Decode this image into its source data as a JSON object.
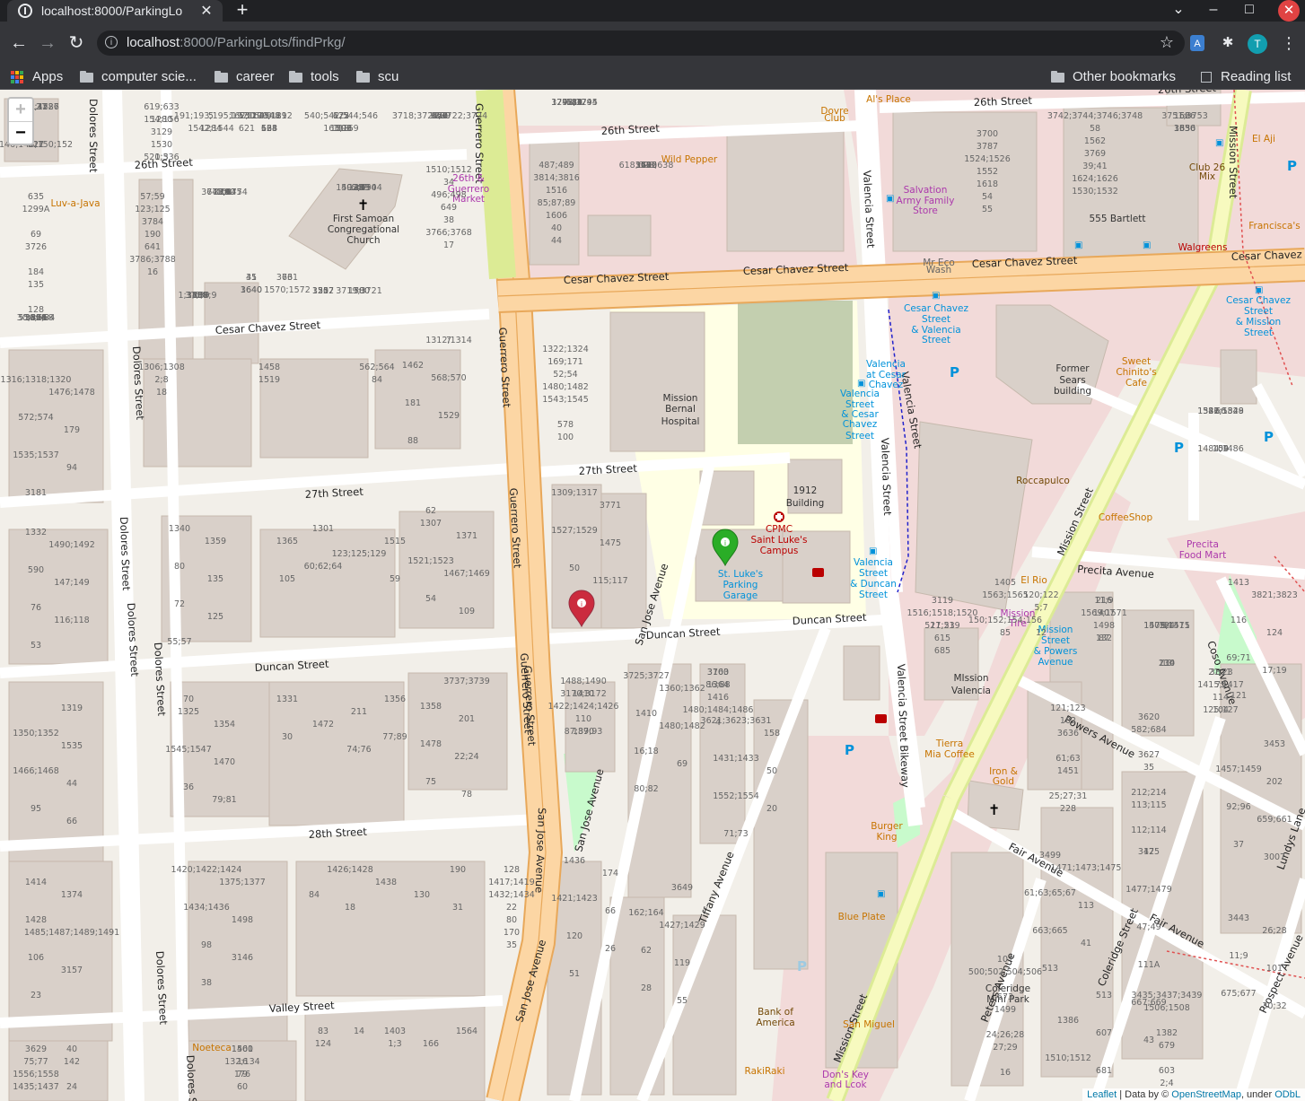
{
  "browser": {
    "tab_title": "localhost:8000/ParkingLo",
    "tab_close": "✕",
    "new_tab": "+",
    "url_host": "localhost",
    "url_rest": ":8000/ParkingLots/findPrkg/",
    "avatar_letter": "T",
    "bookmarks": [
      {
        "label": "Apps",
        "kind": "apps"
      },
      {
        "label": "computer scie...",
        "kind": "folder"
      },
      {
        "label": "career",
        "kind": "folder"
      },
      {
        "label": "tools",
        "kind": "folder"
      },
      {
        "label": "scu",
        "kind": "folder"
      }
    ],
    "other_bookmarks": "Other bookmarks",
    "reading_list": "Reading list"
  },
  "map": {
    "zoom_in": "+",
    "zoom_out": "−",
    "attribution": {
      "leaflet": "Leaflet",
      "sep1": " | Data by © ",
      "osm": "OpenStreetMap",
      "sep2": ", under ",
      "odbl": "ODbL"
    },
    "colors": {
      "background": "#f2efe9",
      "building": "#d9d0c9",
      "primary_road": "#fcd6a4",
      "secondary_road": "#f7fabf",
      "residential_road": "#ffffff",
      "commercial": "#f2dad9",
      "hospital": "#ffffe5",
      "park": "#c8facc",
      "marker_green": "#2aad27",
      "marker_red": "#cb2b3e"
    },
    "street_labels": [
      "26th Street",
      "26th Street",
      "26th Street",
      "26th Street",
      "Cesar Chavez Street",
      "Cesar Chavez Street",
      "Cesar Chavez Street",
      "Cesar Chavez Street",
      "Cesar Chavez Street",
      "27th Street",
      "27th Street",
      "Duncan Street",
      "Duncan Street",
      "Duncan Street",
      "28th Street",
      "Valley Street",
      "Dolores Street",
      "Dolores Street",
      "Dolores Street",
      "Dolores Street",
      "Dolores Street",
      "Dolores Street",
      "Dolores Street",
      "Guerrero Street",
      "Guerrero Street",
      "Guerrero Street",
      "Guerrero Street",
      "Guerrero Street",
      "San Jose Avenue",
      "San Jose Avenue",
      "San Jose Avenue",
      "San Jose Avenue",
      "Valencia Street",
      "Valencia Street",
      "Valencia Street",
      "Valencia Street Bikeway",
      "Mission Street",
      "Mission Street",
      "Mission Street",
      "Tiffany Avenue",
      "Precita Avenue",
      "Powers Avenue",
      "Fair Avenue",
      "Fair Avenue",
      "Coso Avenue",
      "Coleridge Street",
      "Peters Avenue",
      "Prospect Avenue",
      "Lundys Lane"
    ],
    "poi_labels": [
      {
        "text": "First Samoan",
        "color": "#333333"
      },
      {
        "text": "Congregational",
        "color": "#333333"
      },
      {
        "text": "Church",
        "color": "#333333"
      },
      {
        "text": "26th &",
        "color": "#ac39ac"
      },
      {
        "text": "Guerrero",
        "color": "#ac39ac"
      },
      {
        "text": "Market",
        "color": "#ac39ac"
      },
      {
        "text": "Wild Pepper",
        "color": "#c77400"
      },
      {
        "text": "Luv-a-Java",
        "color": "#c77400"
      },
      {
        "text": "Dovre",
        "color": "#c77400"
      },
      {
        "text": "Club",
        "color": "#c77400"
      },
      {
        "text": "Al's Place",
        "color": "#c77400"
      },
      {
        "text": "Salvation",
        "color": "#ac39ac"
      },
      {
        "text": "Army Family",
        "color": "#ac39ac"
      },
      {
        "text": "Store",
        "color": "#ac39ac"
      },
      {
        "text": "Mr Eco",
        "color": "#666666"
      },
      {
        "text": "Wash",
        "color": "#666666"
      },
      {
        "text": "555 Bartlett",
        "color": "#333333"
      },
      {
        "text": "Walgreens",
        "color": "#ba0000"
      },
      {
        "text": "Club 26",
        "color": "#734a08"
      },
      {
        "text": "Mix",
        "color": "#734a08"
      },
      {
        "text": "El Aji",
        "color": "#c77400"
      },
      {
        "text": "Francisca's",
        "color": "#c77400"
      },
      {
        "text": "Mission",
        "color": "#333333"
      },
      {
        "text": "Bernal",
        "color": "#333333"
      },
      {
        "text": "Hospital",
        "color": "#333333"
      },
      {
        "text": "Cesar Chavez",
        "color": "#0092da"
      },
      {
        "text": "Street",
        "color": "#0092da"
      },
      {
        "text": "& Valencia",
        "color": "#0092da"
      },
      {
        "text": "Street",
        "color": "#0092da"
      },
      {
        "text": "Valencia",
        "color": "#0092da"
      },
      {
        "text": "at Cesar",
        "color": "#0092da"
      },
      {
        "text": "Chavez",
        "color": "#0092da"
      },
      {
        "text": "Valencia",
        "color": "#0092da"
      },
      {
        "text": "Street",
        "color": "#0092da"
      },
      {
        "text": "& Cesar",
        "color": "#0092da"
      },
      {
        "text": "Chavez",
        "color": "#0092da"
      },
      {
        "text": "Street",
        "color": "#0092da"
      },
      {
        "text": "Former",
        "color": "#333333"
      },
      {
        "text": "Sears",
        "color": "#333333"
      },
      {
        "text": "building",
        "color": "#333333"
      },
      {
        "text": "Sweet",
        "color": "#c77400"
      },
      {
        "text": "Chinito's",
        "color": "#c77400"
      },
      {
        "text": "Cafe",
        "color": "#c77400"
      },
      {
        "text": "Cesar Chavez",
        "color": "#0092da"
      },
      {
        "text": "Street",
        "color": "#0092da"
      },
      {
        "text": "& Mission",
        "color": "#0092da"
      },
      {
        "text": "Street",
        "color": "#0092da"
      },
      {
        "text": "1912",
        "color": "#333333"
      },
      {
        "text": "Building",
        "color": "#333333"
      },
      {
        "text": "CPMC",
        "color": "#ba0000"
      },
      {
        "text": "Saint Luke's",
        "color": "#ba0000"
      },
      {
        "text": "Campus",
        "color": "#ba0000"
      },
      {
        "text": "St. Luke's",
        "color": "#0092da"
      },
      {
        "text": "Parking",
        "color": "#0092da"
      },
      {
        "text": "Garage",
        "color": "#0092da"
      },
      {
        "text": "Valencia",
        "color": "#0092da"
      },
      {
        "text": "Street",
        "color": "#0092da"
      },
      {
        "text": "& Duncan",
        "color": "#0092da"
      },
      {
        "text": "Street",
        "color": "#0092da"
      },
      {
        "text": "Roccapulco",
        "color": "#734a08"
      },
      {
        "text": "CoffeeShop",
        "color": "#c77400"
      },
      {
        "text": "Precita",
        "color": "#ac39ac"
      },
      {
        "text": "Food Mart",
        "color": "#ac39ac"
      },
      {
        "text": "El Rio",
        "color": "#c77400"
      },
      {
        "text": "Mission",
        "color": "#ac39ac"
      },
      {
        "text": "Tire",
        "color": "#ac39ac"
      },
      {
        "text": "Mission",
        "color": "#0092da"
      },
      {
        "text": "Street",
        "color": "#0092da"
      },
      {
        "text": "& Powers",
        "color": "#0092da"
      },
      {
        "text": "Avenue",
        "color": "#0092da"
      },
      {
        "text": "MIssion",
        "color": "#333333"
      },
      {
        "text": "Valencia",
        "color": "#333333"
      },
      {
        "text": "Tierra",
        "color": "#c77400"
      },
      {
        "text": "Mia Coffee",
        "color": "#c77400"
      },
      {
        "text": "Iron &",
        "color": "#c77400"
      },
      {
        "text": "Gold",
        "color": "#c77400"
      },
      {
        "text": "Burger",
        "color": "#c77400"
      },
      {
        "text": "King",
        "color": "#c77400"
      },
      {
        "text": "Blue Plate",
        "color": "#c77400"
      },
      {
        "text": "Bank of",
        "color": "#734a08"
      },
      {
        "text": "America",
        "color": "#734a08"
      },
      {
        "text": "San Miguel",
        "color": "#c77400"
      },
      {
        "text": "RakiRaki",
        "color": "#c77400"
      },
      {
        "text": "Don's Key",
        "color": "#ac39ac"
      },
      {
        "text": "and Lcok",
        "color": "#ac39ac"
      },
      {
        "text": "Noeteca",
        "color": "#c77400"
      },
      {
        "text": "Coleridge",
        "color": "#333333"
      },
      {
        "text": "Mini Park",
        "color": "#333333"
      }
    ],
    "house_numbers": [
      "1285;1287",
      "1280",
      "1284",
      "1290;1292",
      "1296",
      "1289",
      "1293;1295",
      "1299A",
      "3784",
      "3772;3774",
      "492;494",
      "496;498",
      "487;489",
      "3706",
      "3700",
      "3742;3744;3746;3748",
      "3656",
      "3640",
      "3512",
      "3817",
      "3809",
      "1306;1308",
      "1312;1314",
      "1316;1318;1320",
      "1322;1324",
      "1326;1328",
      "1332",
      "1340",
      "1301",
      "1307",
      "1309;1317",
      "1319",
      "1325",
      "1331",
      "3737;3739",
      "3725;3727",
      "3703",
      "1410",
      "1414",
      "1420;1422;1424",
      "1426;1428",
      "1432;1434",
      "1436",
      "3649",
      "3621;3623;3631",
      "3629",
      "1401",
      "1403",
      "1405",
      "1407",
      "1409;1411",
      "1413",
      "1415;1417",
      "3636",
      "3620",
      "3453",
      "3499",
      "3475",
      "500;502;504;506",
      "3443",
      "3435;3437;3439",
      "513",
      "517;519",
      "521",
      "520;536",
      "530",
      "534",
      "540;542;544;546",
      "3718;3720;3722;3724",
      "3742;3744",
      "3726",
      "3786;3788",
      "3790",
      "1349",
      "3766;3768",
      "3814;3816",
      "3795",
      "3787",
      "3769",
      "3751;3753",
      "3731",
      "3719;3721",
      "1450",
      "1454",
      "1458",
      "1462",
      "1476;1478",
      "1480;1482",
      "1484;1486",
      "1490;1492",
      "1359",
      "1365",
      "1371",
      "3771",
      "1350;1352",
      "1354",
      "1356",
      "1358",
      "1360;1362",
      "1364",
      "1370",
      "1374",
      "1375;1377",
      "190",
      "170",
      "174",
      "162;164",
      "158",
      "142",
      "132;134",
      "124",
      "120;122",
      "216",
      "210",
      "3821;3823",
      "3811",
      "1451",
      "3627",
      "1457;1459",
      "1471;1473;1475",
      "1477;1479",
      "1499",
      "26;28",
      "1382",
      "1386",
      "3119",
      "3127",
      "3129",
      "191;193;195;197",
      "179;181",
      "163;169",
      "157",
      "141",
      "135",
      "123;125",
      "101",
      "1502;1504",
      "1510;1512",
      "1516",
      "1520",
      "1524;1526",
      "1530;1532",
      "1536",
      "45",
      "25",
      "1;3;5;7;9",
      "556;558",
      "562;564",
      "568;570",
      "572;574",
      "578",
      "582;584",
      "590",
      "80",
      "1515",
      "1521;1523",
      "1527;1529",
      "1535",
      "1545;1547",
      "211",
      "201",
      "1410",
      "1416",
      "1422;1424;1426",
      "1428",
      "1434;1436",
      "1438",
      "1417;1419",
      "1421;1423",
      "1427;1429",
      "1431;1433",
      "1435;1437",
      "176",
      "166",
      "150;152;154;156",
      "132",
      "124",
      "116",
      "104",
      "228",
      "212;214",
      "202",
      "61;63;65;67",
      "47;49",
      "27;29",
      "11;9",
      "603",
      "607",
      "615",
      "617",
      "619;633",
      "621",
      "623",
      "625",
      "629",
      "631",
      "635",
      "641",
      "643;645",
      "647",
      "649",
      "85;87;89",
      "618;628;638",
      "1552",
      "1562",
      "1566",
      "1570;1572",
      "1580",
      "1588",
      "1596",
      "2;8",
      "181",
      "179",
      "169;171",
      "159",
      "147;149",
      "135",
      "123;125;129",
      "1467;1469",
      "1475",
      "1466;1468",
      "1470",
      "1472",
      "1478",
      "1480;1482",
      "1480;1484;1486",
      "1488;1490",
      "1485;1487;1489;1491",
      "1498",
      "84",
      "80",
      "66",
      "62",
      "50",
      "40",
      "60",
      "14",
      "12",
      "1498",
      "134",
      "124",
      "114",
      "102",
      "112;114",
      "92;96",
      "113",
      "111A",
      "107",
      "101",
      "1506;1508",
      "1510;1512",
      "1516;1518;1520",
      "1522;1526",
      "1530",
      "1542;1544",
      "1548",
      "1503",
      "87",
      "75;77",
      "69",
      "57;59",
      "45;47",
      "21",
      "17",
      "1606",
      "1612",
      "1618",
      "1624;1626",
      "1630",
      "1640",
      "1507",
      "1509",
      "1511",
      "1519",
      "1529",
      "1535;1537",
      "1543;1545",
      "1547;1549",
      "76",
      "72",
      "60;62;64",
      "54",
      "50",
      "44",
      "36",
      "30",
      "22;24",
      "16;18",
      "4",
      "110",
      "106",
      "98",
      "130",
      "128",
      "120",
      "119",
      "1552;1554",
      "1556;1558",
      "1560",
      "1564",
      "1563;1565",
      "1569;1571",
      "1573;1575",
      "69;71",
      "75",
      "61;63",
      "582;684",
      "659;661",
      "663;665",
      "667;669",
      "673",
      "675;677",
      "679",
      "681",
      "685",
      "146;148;150;152",
      "154;156",
      "162;164",
      "168",
      "172",
      "176",
      "180",
      "184",
      "190",
      "16",
      "18",
      "34",
      "40",
      "48",
      "54",
      "58",
      "62",
      "66",
      "70",
      "76",
      "80",
      "84",
      "88",
      "94",
      "100",
      "104",
      "116;118",
      "125",
      "105",
      "109",
      "115;117",
      "95",
      "79;81",
      "77;89",
      "75",
      "69",
      "3160",
      "3170;3172",
      "3157",
      "3146",
      "18",
      "22",
      "26",
      "28",
      "20",
      "24",
      "16",
      "1;3",
      "5;7",
      "11;9",
      "13",
      "17;19",
      "21;23",
      "25;27;31",
      "35",
      "37",
      "41",
      "43",
      "24;26;28",
      "30;32",
      "2;4",
      "29;31",
      "21;23",
      "45;47",
      "1;3",
      "5",
      "9",
      "118",
      "120",
      "124",
      "128",
      "16",
      "24",
      "34",
      "38",
      "44",
      "61",
      "55",
      "39;41",
      "35",
      "31",
      "25",
      "37;39",
      "30;32;34",
      "18",
      "7",
      "3181",
      "52;54",
      "66",
      "53",
      "55;57",
      "59",
      "62",
      "64",
      "66",
      "70",
      "74;76",
      "78",
      "80;82",
      "86;88",
      "87;89;93",
      "23",
      "38",
      "31",
      "35",
      "51",
      "55",
      "71;73",
      "75;77",
      "79",
      "83",
      "85",
      "87",
      "94",
      "121",
      "125;127",
      "121;123",
      "113;115",
      "3007",
      "513",
      "12",
      "16"
    ],
    "markers": [
      {
        "name": "parking-garage",
        "color": "green"
      },
      {
        "name": "selected-location",
        "color": "red"
      }
    ]
  }
}
